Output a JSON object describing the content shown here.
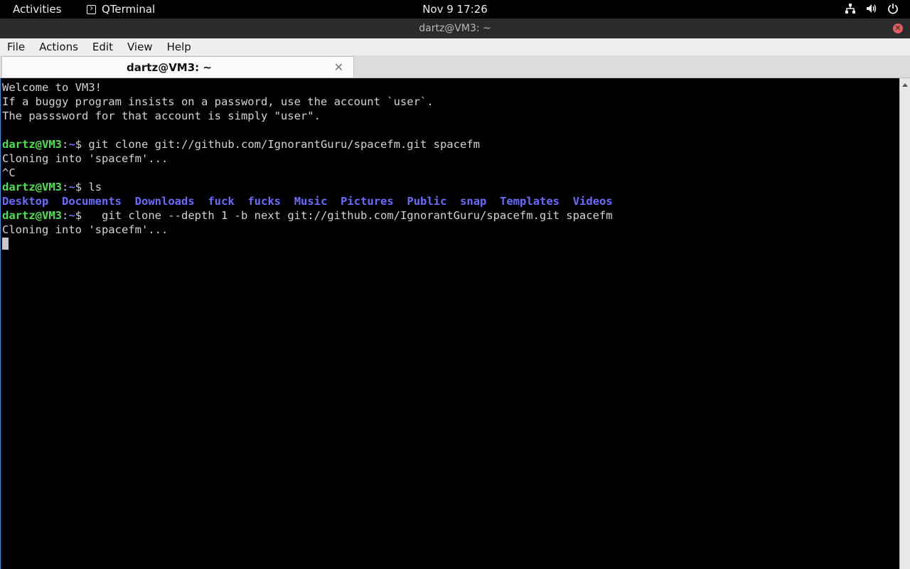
{
  "topbar": {
    "activities": "Activities",
    "app_name": "QTerminal",
    "app_icon": "terminal-icon",
    "clock": "Nov 9  17:26",
    "tray_icons": [
      "network-icon",
      "volume-icon",
      "power-icon"
    ]
  },
  "window": {
    "title": "dartz@VM3: ~",
    "close_icon": "close-icon",
    "close_color": "#e05d5d"
  },
  "menubar": {
    "items": [
      "File",
      "Actions",
      "Edit",
      "View",
      "Help"
    ]
  },
  "tabs": [
    {
      "label": "dartz@VM3: ~",
      "close_glyph": "✕"
    }
  ],
  "terminal": {
    "colors": {
      "background": "#000000",
      "foreground": "#d3d3d3",
      "prompt_user": "#4ee04e",
      "prompt_path": "#6b6bff",
      "directory": "#6b6bff"
    },
    "lines": [
      {
        "text": "Welcome to VM3!"
      },
      {
        "text": "If a buggy program insists on a password, use the account `user`."
      },
      {
        "text": "The passsword for that account is simply \"user\"."
      },
      {
        "text": ""
      },
      {
        "prompt": {
          "user": "dartz@VM3",
          "colon": ":",
          "path": "~",
          "sym": "$"
        },
        "command": " git clone git://github.com/IgnorantGuru/spacefm.git spacefm"
      },
      {
        "text": "Cloning into 'spacefm'..."
      },
      {
        "text": "^C"
      },
      {
        "prompt": {
          "user": "dartz@VM3",
          "colon": ":",
          "path": "~",
          "sym": "$"
        },
        "command": " ls"
      },
      {
        "dirs": [
          "Desktop",
          "Documents",
          "Downloads",
          "fuck",
          "fucks",
          "Music",
          "Pictures",
          "Public",
          "snap",
          "Templates",
          "Videos"
        ]
      },
      {
        "prompt": {
          "user": "dartz@VM3",
          "colon": ":",
          "path": "~",
          "sym": "$"
        },
        "command": "   git clone --depth 1 -b next git://github.com/IgnorantGuru/spacefm.git spacefm"
      },
      {
        "text": "Cloning into 'spacefm'..."
      },
      {
        "cursor": true
      }
    ]
  }
}
